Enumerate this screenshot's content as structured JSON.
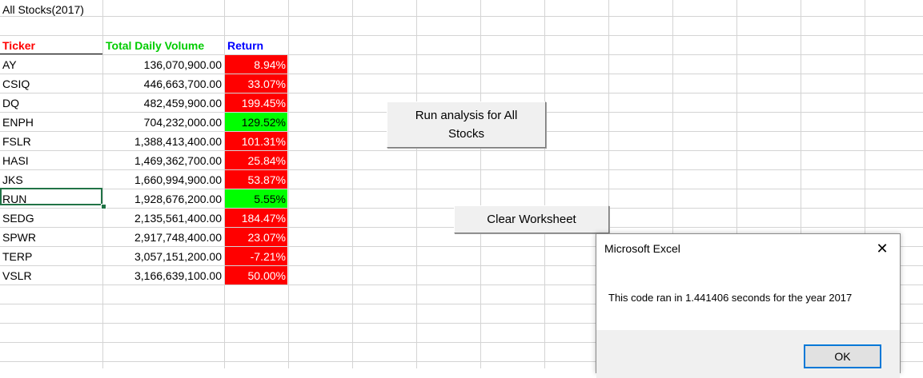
{
  "sheet": {
    "title": "All Stocks(2017)",
    "headers": {
      "ticker": "Ticker",
      "volume": "Total Daily Volume",
      "return": "Return"
    },
    "header_colors": {
      "ticker": "#ff0000",
      "volume": "#00cc00",
      "return": "#0000ff"
    },
    "rows": [
      {
        "ticker": "AY",
        "volume": "136,070,900.00",
        "return": "8.94%",
        "status": "negative"
      },
      {
        "ticker": "CSIQ",
        "volume": "446,663,700.00",
        "return": "33.07%",
        "status": "negative"
      },
      {
        "ticker": "DQ",
        "volume": "482,459,900.00",
        "return": "199.45%",
        "status": "negative"
      },
      {
        "ticker": "ENPH",
        "volume": "704,232,000.00",
        "return": "129.52%",
        "status": "positive"
      },
      {
        "ticker": "FSLR",
        "volume": "1,388,413,400.00",
        "return": "101.31%",
        "status": "negative"
      },
      {
        "ticker": "HASI",
        "volume": "1,469,362,700.00",
        "return": "25.84%",
        "status": "negative"
      },
      {
        "ticker": "JKS",
        "volume": "1,660,994,900.00",
        "return": "53.87%",
        "status": "negative"
      },
      {
        "ticker": "RUN",
        "volume": "1,928,676,200.00",
        "return": "5.55%",
        "status": "positive"
      },
      {
        "ticker": "SEDG",
        "volume": "2,135,561,400.00",
        "return": "184.47%",
        "status": "negative"
      },
      {
        "ticker": "SPWR",
        "volume": "2,917,748,400.00",
        "return": "23.07%",
        "status": "negative"
      },
      {
        "ticker": "TERP",
        "volume": "3,057,151,200.00",
        "return": "-7.21%",
        "status": "negative"
      },
      {
        "ticker": "VSLR",
        "volume": "3,166,639,100.00",
        "return": "50.00%",
        "status": "negative"
      }
    ],
    "colors": {
      "positive": "#00ff00",
      "negative": "#ff0000",
      "selection": "#217346"
    }
  },
  "buttons": {
    "run_label": "Run analysis for All Stocks",
    "clear_label": "Clear Worksheet"
  },
  "dialog": {
    "title": "Microsoft Excel",
    "message": "This code ran in 1.441406 seconds for the year 2017",
    "ok_label": "OK",
    "close_icon": "close-icon"
  }
}
